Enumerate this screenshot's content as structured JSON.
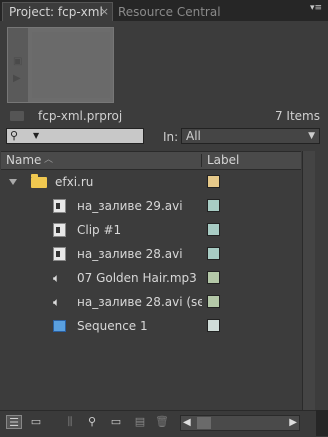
{
  "tabs": [
    {
      "label": "Project: fcp-xml",
      "close": "×",
      "active": true
    },
    {
      "label": "Resource Central",
      "active": false
    }
  ],
  "panel_menu_icon": "≡",
  "project": {
    "name": "fcp-xml.prproj",
    "item_count": "7 Items"
  },
  "search": {
    "value": "",
    "icon": "search-icon"
  },
  "in_filter": {
    "label": "In:",
    "value": "All"
  },
  "table": {
    "columns": [
      "Name",
      "Label"
    ],
    "rows": [
      {
        "name": "efxi.ru",
        "type": "folder",
        "label_color": "#e6c98a",
        "indent": 0
      },
      {
        "name": "на_заливе 29.avi",
        "type": "video",
        "label_color": "#a8ccc4",
        "indent": 1
      },
      {
        "name": "Clip #1",
        "type": "video",
        "label_color": "#a8ccc4",
        "indent": 1
      },
      {
        "name": "на_заливе 28.avi",
        "type": "video",
        "label_color": "#a8ccc4",
        "indent": 1
      },
      {
        "name": "07 Golden Hair.mp3",
        "type": "audio",
        "label_color": "#b4c8a8",
        "indent": 1
      },
      {
        "name": "на_заливе 28.avi (se",
        "type": "audio",
        "label_color": "#b4c8a8",
        "indent": 1
      },
      {
        "name": "Sequence 1",
        "type": "sequence",
        "label_color": "#d0dcd8",
        "indent": 1
      }
    ]
  },
  "colors": {
    "panel_bg": "#3c3c3c",
    "folder": "#f0c850",
    "sequence": "#5aa0e0"
  }
}
